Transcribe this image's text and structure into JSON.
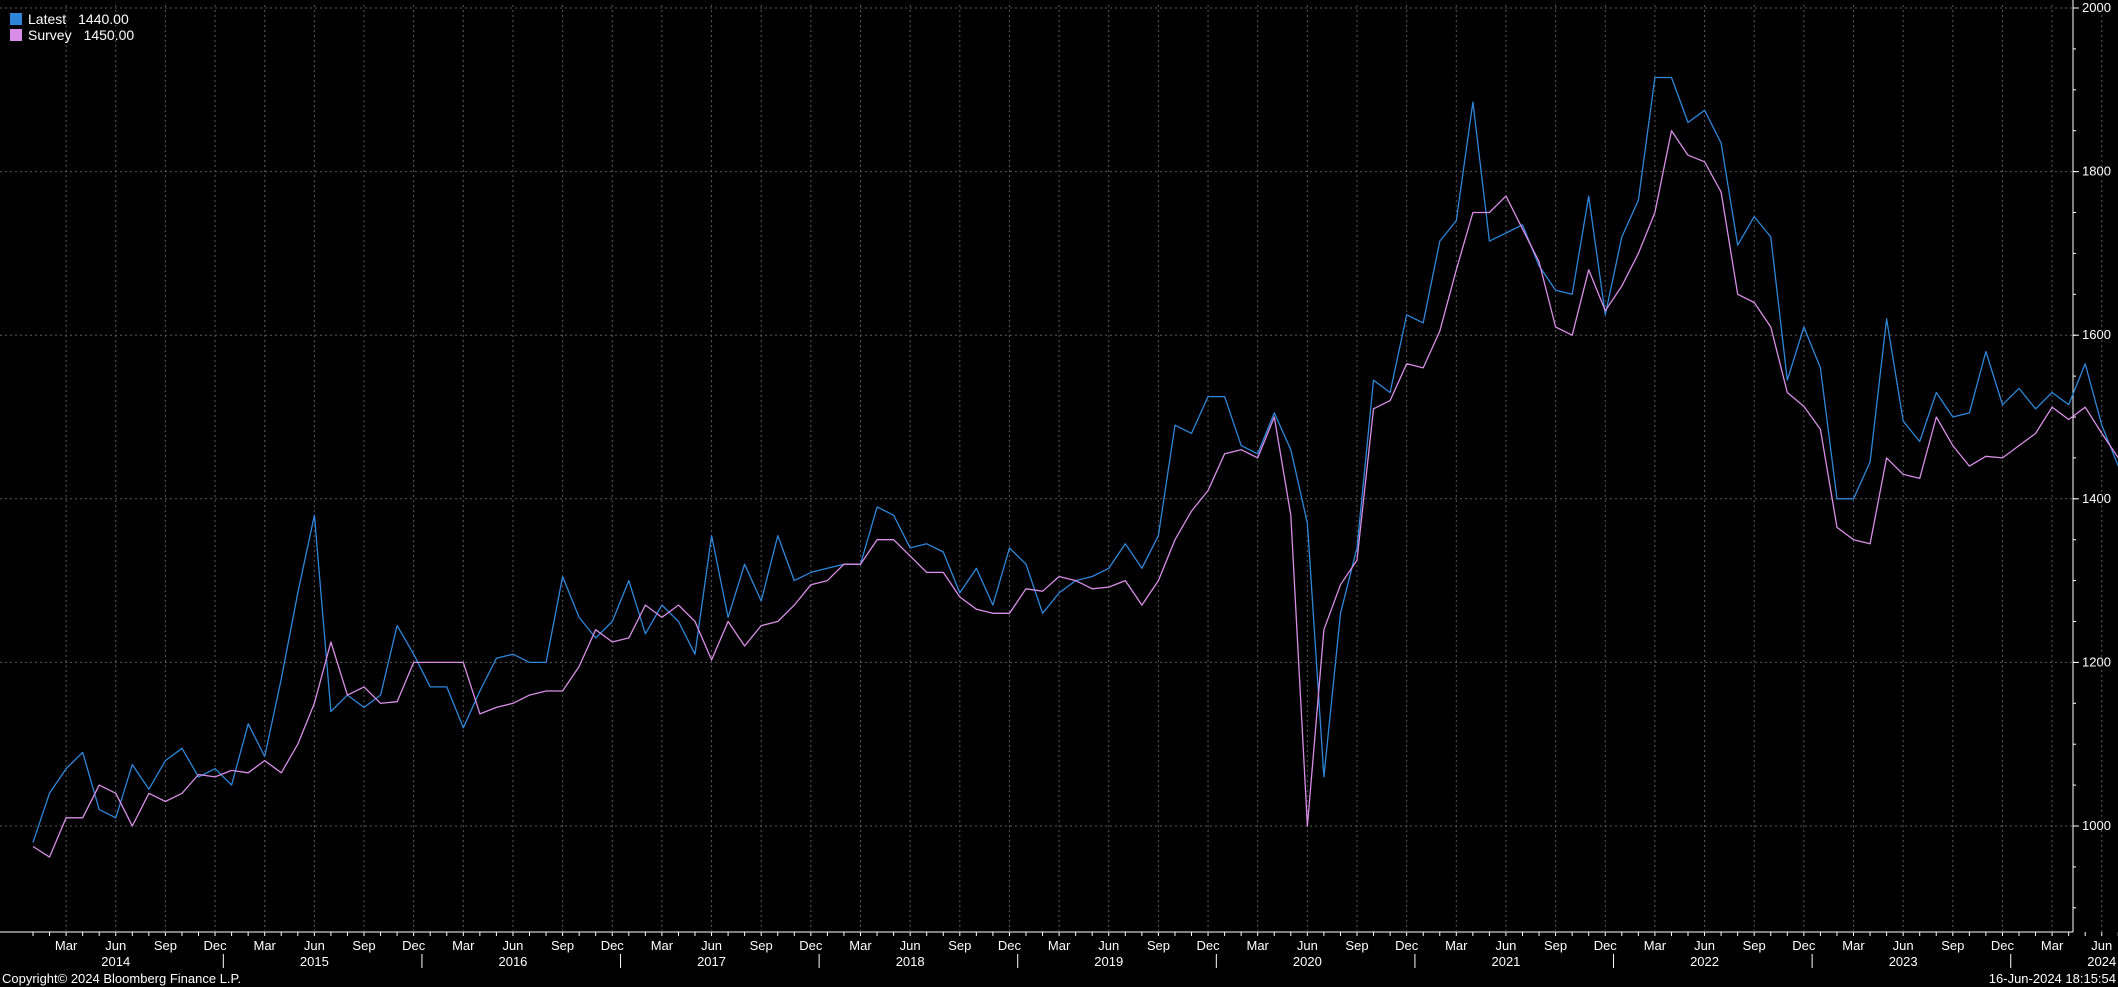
{
  "colors": {
    "background": "#000000",
    "latest": "#2f86d9",
    "survey": "#d88ee6",
    "grid": "#5a5a5a",
    "text": "#ffffff"
  },
  "legend": [
    {
      "name": "Latest",
      "value": "1440.00",
      "color": "#2f86d9"
    },
    {
      "name": "Survey",
      "value": "1450.00",
      "color": "#d88ee6"
    }
  ],
  "footer": {
    "copyright": "Copyright© 2024 Bloomberg Finance L.P.",
    "timestamp": "16-Jun-2024 18:15:54"
  },
  "chart_data": {
    "type": "line",
    "title": "",
    "xlabel": "",
    "ylabel": "",
    "x_start": "2014-01",
    "x_range": [
      "2014-01",
      "2024-06"
    ],
    "ylim": [
      870,
      2000
    ],
    "y_ticks": [
      1000,
      1200,
      1400,
      1600,
      1800,
      2000
    ],
    "grid": true,
    "legend_position": "top-left",
    "month_ticks": [
      "Mar",
      "Jun",
      "Sep",
      "Dec"
    ],
    "last_month_label": "Jun",
    "year_labels": [
      "2014",
      "2015",
      "2016",
      "2017",
      "2018",
      "2019",
      "2020",
      "2021",
      "2022",
      "2023",
      "2024"
    ],
    "series": [
      {
        "name": "Latest",
        "color": "#2f86d9",
        "values": [
          980,
          1040,
          1070,
          1090,
          1020,
          1010,
          1075,
          1045,
          1080,
          1095,
          1060,
          1070,
          1050,
          1125,
          1085,
          1180,
          1285,
          1380,
          1140,
          1160,
          1145,
          1160,
          1245,
          1210,
          1170,
          1170,
          1120,
          1165,
          1205,
          1210,
          1200,
          1200,
          1305,
          1255,
          1230,
          1250,
          1300,
          1235,
          1270,
          1250,
          1210,
          1355,
          1255,
          1320,
          1275,
          1355,
          1300,
          1310,
          1315,
          1320,
          1320,
          1390,
          1380,
          1340,
          1345,
          1335,
          1285,
          1315,
          1270,
          1340,
          1320,
          1260,
          1285,
          1300,
          1305,
          1315,
          1345,
          1315,
          1355,
          1490,
          1480,
          1525,
          1525,
          1465,
          1455,
          1505,
          1460,
          1370,
          1060,
          1260,
          1340,
          1545,
          1530,
          1625,
          1615,
          1715,
          1740,
          1885,
          1715,
          1725,
          1735,
          1685,
          1655,
          1650,
          1770,
          1625,
          1720,
          1765,
          1915,
          1915,
          1860,
          1875,
          1835,
          1710,
          1745,
          1720,
          1545,
          1610,
          1560,
          1400,
          1400,
          1445,
          1620,
          1495,
          1470,
          1530,
          1500,
          1505,
          1580,
          1515,
          1535,
          1510,
          1530,
          1515,
          1565,
          1490,
          1440
        ]
      },
      {
        "name": "Survey",
        "color": "#d88ee6",
        "values": [
          975,
          962,
          1010,
          1010,
          1050,
          1040,
          1000,
          1040,
          1030,
          1040,
          1063,
          1060,
          1068,
          1065,
          1080,
          1065,
          1100,
          1150,
          1225,
          1160,
          1170,
          1150,
          1152,
          1200,
          1200,
          1200,
          1200,
          1137,
          1145,
          1150,
          1160,
          1165,
          1165,
          1195,
          1240,
          1225,
          1230,
          1270,
          1255,
          1270,
          1250,
          1203,
          1250,
          1220,
          1245,
          1250,
          1270,
          1295,
          1300,
          1320,
          1320,
          1350,
          1350,
          1330,
          1310,
          1310,
          1280,
          1265,
          1260,
          1260,
          1290,
          1287,
          1305,
          1300,
          1290,
          1292,
          1300,
          1270,
          1300,
          1350,
          1385,
          1410,
          1455,
          1460,
          1450,
          1500,
          1380,
          1000,
          1240,
          1295,
          1325,
          1510,
          1520,
          1565,
          1560,
          1605,
          1680,
          1750,
          1750,
          1770,
          1730,
          1690,
          1610,
          1600,
          1680,
          1630,
          1660,
          1700,
          1750,
          1850,
          1820,
          1812,
          1775,
          1650,
          1640,
          1610,
          1530,
          1513,
          1485,
          1365,
          1350,
          1345,
          1450,
          1430,
          1425,
          1500,
          1465,
          1440,
          1452,
          1450,
          1465,
          1480,
          1512,
          1497,
          1512,
          1480,
          1450
        ]
      }
    ]
  }
}
